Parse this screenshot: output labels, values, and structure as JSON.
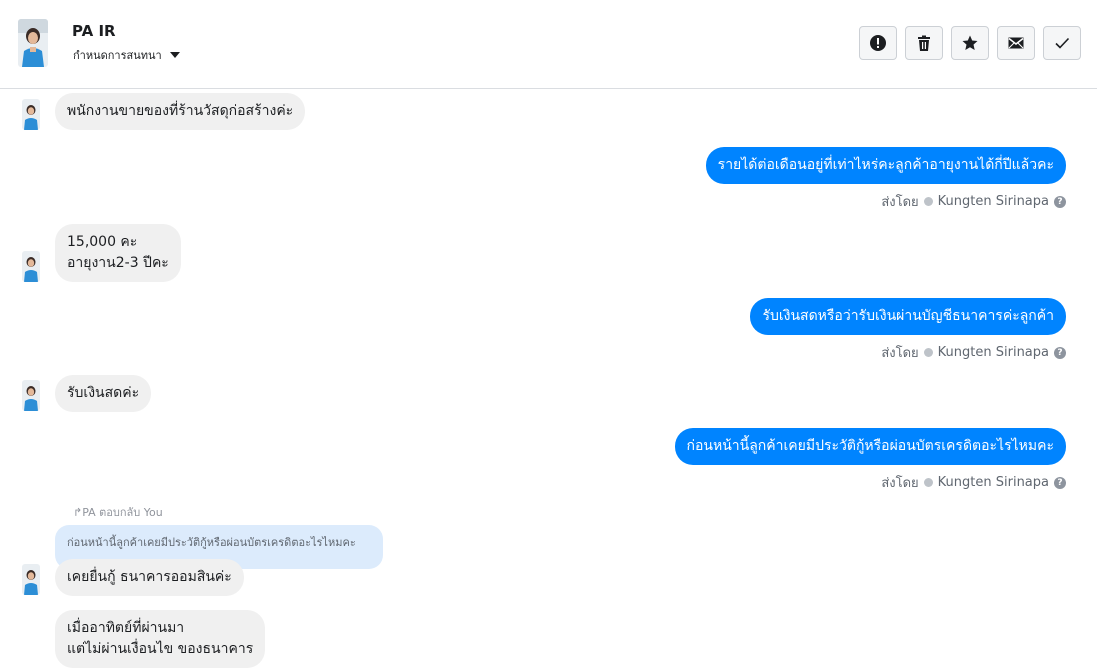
{
  "header": {
    "name": "PA IR",
    "assign_label": "กำหนดการสนทนา",
    "actions": [
      {
        "icon": "alert-icon",
        "label": "mark-spam"
      },
      {
        "icon": "trash-icon",
        "label": "delete"
      },
      {
        "icon": "star-icon",
        "label": "star"
      },
      {
        "icon": "envelope-icon",
        "label": "mark-unread"
      },
      {
        "icon": "check-icon",
        "label": "mark-done"
      }
    ]
  },
  "messages": {
    "m1": "พนักงานขายของที่ร้านวัสดุก่อสร้างค่ะ",
    "m2": "รายได้ต่อเดือนอยู่ที่เท่าไหร่คะลูกค้าอายุงานได้กี่ปีแล้วคะ",
    "m3_line1": "15,000 คะ",
    "m3_line2": "อายุงาน2-3 ปีคะ",
    "m4": "รับเงินสดหรือว่ารับเงินผ่านบัญชีธนาคารค่ะลูกค้า",
    "m5": "รับเงินสดค่ะ",
    "m6": "ก่อนหน้านี้ลูกค้าเคยมีประวัติกู้หรือผ่อนบัตรเครดิตอะไรไหมคะ",
    "reply_label": "↱PA ตอบกลับ You",
    "reply_quote": "ก่อนหน้านี้ลูกค้าเคยมีประวัติกู้หรือผ่อนบัตรเครดิตอะไรไหมคะ",
    "m7": "เคยยื่นกู้ ธนาคารออมสินค่ะ",
    "m8_line1": "เมื่ออาทิตย์ที่ผ่านมา",
    "m8_line2": "แต่ไม่ผ่านเงื่อนไข ของธนาคาร"
  },
  "sent_by": {
    "prefix": "ส่งโดย",
    "agent": "Kungten Sirinapa",
    "help": "?"
  },
  "colors": {
    "outgoing": "#0084ff",
    "incoming": "#f0f0f0",
    "reply_quote_bg": "#dcebfc"
  }
}
